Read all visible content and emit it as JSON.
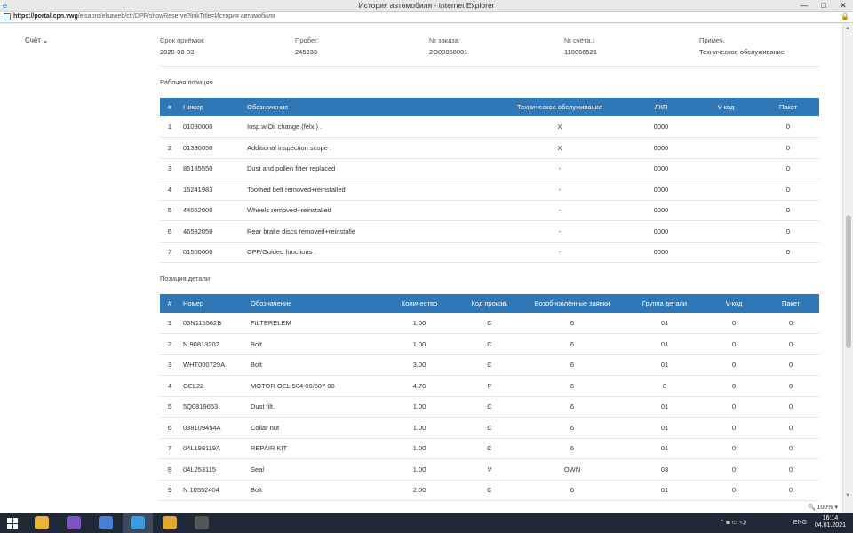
{
  "window": {
    "title": "История автомобиля - Internet Explorer",
    "minimize": "—",
    "maximize": "□",
    "close": "✕"
  },
  "address": {
    "url_host": "https://portal.cpn.vwg",
    "url_path": "/elsapro/elsaweb/ctr/DPF/showReserve?linkTitle=История автомобиля"
  },
  "account": {
    "label": "Счёт"
  },
  "info": {
    "fields": [
      {
        "label": "Срок приёмки:",
        "value": "2020-08-03"
      },
      {
        "label": "Пробег:",
        "value": "245333"
      },
      {
        "label": "№ заказа:",
        "value": "2O00858001"
      },
      {
        "label": "№ счёта.:",
        "value": "110066521"
      },
      {
        "label": "Примеч.",
        "value": "Техническое обслуживание"
      }
    ]
  },
  "work": {
    "title": "Рабочая позиция",
    "headers": [
      "#",
      "Номер",
      "Обозначение",
      "Техническое обслуживание",
      "ЛКП",
      "V-код",
      "Пакет"
    ],
    "rows": [
      [
        "1",
        "01090000",
        "Insp.w.Oil change (felx.) .",
        "X",
        "0000",
        "",
        "0"
      ],
      [
        "2",
        "01390050",
        "Additional inspection scope .",
        "X",
        "0000",
        "",
        "0"
      ],
      [
        "3",
        "85185550",
        "Dust and pollen filter replaced",
        "-",
        "0000",
        "",
        "0"
      ],
      [
        "4",
        "15241983",
        "Toothed belt removed+reinstalled",
        "-",
        "0000",
        "",
        "0"
      ],
      [
        "5",
        "44052000",
        "Wheels removed+reinstalled",
        "-",
        "0000",
        "",
        "0"
      ],
      [
        "6",
        "46532050",
        "Rear brake discs removed+reinstalle",
        "-",
        "0000",
        "",
        "0"
      ],
      [
        "7",
        "01500000",
        "GFF/Guided functions .",
        "-",
        "0000",
        "",
        "0"
      ]
    ]
  },
  "parts": {
    "title": "Позиция детали",
    "headers": [
      "#",
      "Номер",
      "Обозначение",
      "Количество",
      "Код произв.",
      "Возобновлённые заявки",
      "Группа детали",
      "V-код",
      "Пакет"
    ],
    "rows": [
      [
        "1",
        "03N115562B",
        "FILTERELEM",
        "1.00",
        "C",
        "6",
        "01",
        "0",
        "0"
      ],
      [
        "2",
        "N 90813202",
        "Bolt",
        "1.00",
        "C",
        "6",
        "01",
        "0",
        "0"
      ],
      [
        "3",
        "WHT000729A",
        "Bolt",
        "3.00",
        "C",
        "6",
        "01",
        "0",
        "0"
      ],
      [
        "4",
        "OEL22",
        "MOTOR OEL 504 00/507 00",
        "4.70",
        "F",
        "6",
        "0",
        "0",
        "0"
      ],
      [
        "5",
        "5Q0819653",
        "Dust filt.",
        "1.00",
        "C",
        "6",
        "01",
        "0",
        "0"
      ],
      [
        "6",
        "038109454A",
        "Collar nut",
        "1.00",
        "C",
        "6",
        "01",
        "0",
        "0"
      ],
      [
        "7",
        "04L198119A",
        "REPAIR KIT",
        "1.00",
        "C",
        "6",
        "01",
        "0",
        "0"
      ],
      [
        "8",
        "04L253115",
        "Seal",
        "1.00",
        "V",
        "OWN",
        "03",
        "0",
        "0"
      ],
      [
        "9",
        "N 10552404",
        "Bolt",
        "2.00",
        "C",
        "6",
        "01",
        "0",
        "0"
      ]
    ]
  },
  "status": {
    "zoom": "100%"
  },
  "taskbar": {
    "apps": [
      {
        "name": "file-explorer-icon",
        "color": "#e8b53a"
      },
      {
        "name": "viber-icon",
        "color": "#7d53c2"
      },
      {
        "name": "remote-desktop-icon",
        "color": "#4b7fd1"
      },
      {
        "name": "internet-explorer-icon",
        "color": "#3a9bde"
      },
      {
        "name": "chrome-icon",
        "color": "#e0a82e"
      },
      {
        "name": "app-icon",
        "color": "#555555"
      }
    ],
    "tray_lang": "ENG",
    "time": "16:14",
    "date": "04.01.2021"
  }
}
